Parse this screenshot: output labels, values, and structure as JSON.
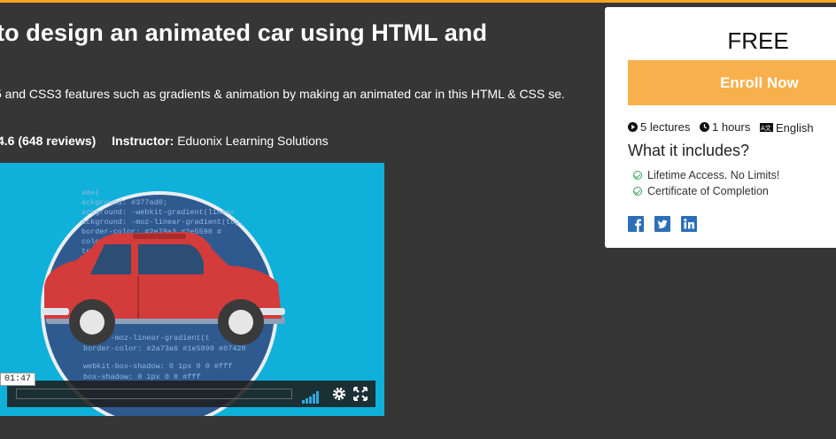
{
  "colors": {
    "accent": "#f5a623",
    "enroll": "#f7b04c",
    "background": "#363636",
    "video_bg": "#0fb0d9",
    "social": "#2d6fb7",
    "check": "#3aa655"
  },
  "course": {
    "title": "to design an animated car using HTML and",
    "description": "5 and CSS3 features such as gradients & animation by making an animated car in this HTML & CSS se.",
    "rating": "4.6 (648 reviews)",
    "instructor_label": "Instructor:",
    "instructor_name": "Eduonix Learning Solutions"
  },
  "video": {
    "time": "01:47",
    "code_lines": [
      "ame{",
      "ackground: #377ad0;",
      "ackground: -webkit-gradient(linear",
      "ackground: -moz-linear-gradient(top,",
      "border-color: #2e79a3 #2e5598 #",
      "color",
      "te",
      "ound: -moz-linear-gradient(t",
      "border-color: #2a73a6 #1e5899 #07428",
      "webkit-box-shadow: 0 1px 0 0 #fff",
      "box-shadow: 0 1px 0 0 #fff"
    ],
    "controls": [
      "volume-icon",
      "settings-icon",
      "fullscreen-icon"
    ]
  },
  "sidebar": {
    "price": "FREE",
    "enroll_label": "Enroll Now",
    "facts": [
      {
        "icon": "play-circle-icon",
        "text": "5 lectures"
      },
      {
        "icon": "clock-icon",
        "text": "1 hours"
      },
      {
        "icon": "language-icon",
        "text": "English"
      }
    ],
    "includes_title": "What it includes?",
    "includes": [
      "Lifetime Access. No Limits!",
      "Certificate of Completion"
    ],
    "social": [
      "facebook-icon",
      "twitter-icon",
      "linkedin-icon"
    ]
  }
}
